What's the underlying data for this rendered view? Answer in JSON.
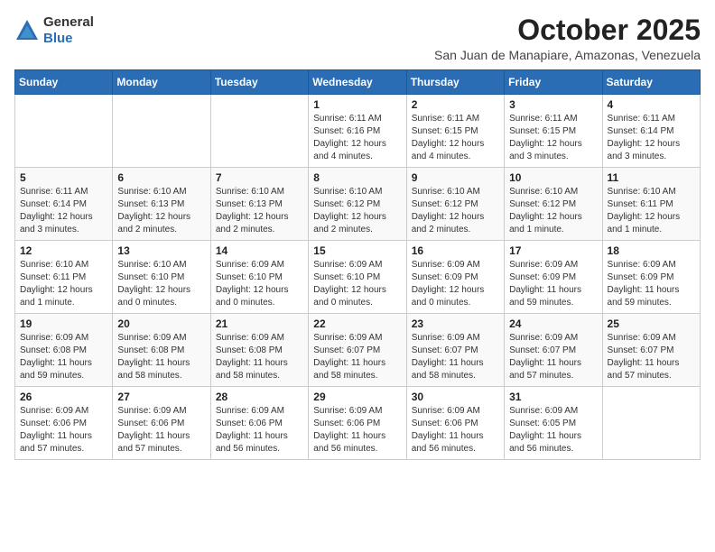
{
  "logo": {
    "general": "General",
    "blue": "Blue"
  },
  "header": {
    "title": "October 2025",
    "subtitle": "San Juan de Manapiare, Amazonas, Venezuela"
  },
  "weekdays": [
    "Sunday",
    "Monday",
    "Tuesday",
    "Wednesday",
    "Thursday",
    "Friday",
    "Saturday"
  ],
  "weeks": [
    [
      {
        "day": "",
        "info": ""
      },
      {
        "day": "",
        "info": ""
      },
      {
        "day": "",
        "info": ""
      },
      {
        "day": "1",
        "info": "Sunrise: 6:11 AM\nSunset: 6:16 PM\nDaylight: 12 hours\nand 4 minutes."
      },
      {
        "day": "2",
        "info": "Sunrise: 6:11 AM\nSunset: 6:15 PM\nDaylight: 12 hours\nand 4 minutes."
      },
      {
        "day": "3",
        "info": "Sunrise: 6:11 AM\nSunset: 6:15 PM\nDaylight: 12 hours\nand 3 minutes."
      },
      {
        "day": "4",
        "info": "Sunrise: 6:11 AM\nSunset: 6:14 PM\nDaylight: 12 hours\nand 3 minutes."
      }
    ],
    [
      {
        "day": "5",
        "info": "Sunrise: 6:11 AM\nSunset: 6:14 PM\nDaylight: 12 hours\nand 3 minutes."
      },
      {
        "day": "6",
        "info": "Sunrise: 6:10 AM\nSunset: 6:13 PM\nDaylight: 12 hours\nand 2 minutes."
      },
      {
        "day": "7",
        "info": "Sunrise: 6:10 AM\nSunset: 6:13 PM\nDaylight: 12 hours\nand 2 minutes."
      },
      {
        "day": "8",
        "info": "Sunrise: 6:10 AM\nSunset: 6:12 PM\nDaylight: 12 hours\nand 2 minutes."
      },
      {
        "day": "9",
        "info": "Sunrise: 6:10 AM\nSunset: 6:12 PM\nDaylight: 12 hours\nand 2 minutes."
      },
      {
        "day": "10",
        "info": "Sunrise: 6:10 AM\nSunset: 6:12 PM\nDaylight: 12 hours\nand 1 minute."
      },
      {
        "day": "11",
        "info": "Sunrise: 6:10 AM\nSunset: 6:11 PM\nDaylight: 12 hours\nand 1 minute."
      }
    ],
    [
      {
        "day": "12",
        "info": "Sunrise: 6:10 AM\nSunset: 6:11 PM\nDaylight: 12 hours\nand 1 minute."
      },
      {
        "day": "13",
        "info": "Sunrise: 6:10 AM\nSunset: 6:10 PM\nDaylight: 12 hours\nand 0 minutes."
      },
      {
        "day": "14",
        "info": "Sunrise: 6:09 AM\nSunset: 6:10 PM\nDaylight: 12 hours\nand 0 minutes."
      },
      {
        "day": "15",
        "info": "Sunrise: 6:09 AM\nSunset: 6:10 PM\nDaylight: 12 hours\nand 0 minutes."
      },
      {
        "day": "16",
        "info": "Sunrise: 6:09 AM\nSunset: 6:09 PM\nDaylight: 12 hours\nand 0 minutes."
      },
      {
        "day": "17",
        "info": "Sunrise: 6:09 AM\nSunset: 6:09 PM\nDaylight: 11 hours\nand 59 minutes."
      },
      {
        "day": "18",
        "info": "Sunrise: 6:09 AM\nSunset: 6:09 PM\nDaylight: 11 hours\nand 59 minutes."
      }
    ],
    [
      {
        "day": "19",
        "info": "Sunrise: 6:09 AM\nSunset: 6:08 PM\nDaylight: 11 hours\nand 59 minutes."
      },
      {
        "day": "20",
        "info": "Sunrise: 6:09 AM\nSunset: 6:08 PM\nDaylight: 11 hours\nand 58 minutes."
      },
      {
        "day": "21",
        "info": "Sunrise: 6:09 AM\nSunset: 6:08 PM\nDaylight: 11 hours\nand 58 minutes."
      },
      {
        "day": "22",
        "info": "Sunrise: 6:09 AM\nSunset: 6:07 PM\nDaylight: 11 hours\nand 58 minutes."
      },
      {
        "day": "23",
        "info": "Sunrise: 6:09 AM\nSunset: 6:07 PM\nDaylight: 11 hours\nand 58 minutes."
      },
      {
        "day": "24",
        "info": "Sunrise: 6:09 AM\nSunset: 6:07 PM\nDaylight: 11 hours\nand 57 minutes."
      },
      {
        "day": "25",
        "info": "Sunrise: 6:09 AM\nSunset: 6:07 PM\nDaylight: 11 hours\nand 57 minutes."
      }
    ],
    [
      {
        "day": "26",
        "info": "Sunrise: 6:09 AM\nSunset: 6:06 PM\nDaylight: 11 hours\nand 57 minutes."
      },
      {
        "day": "27",
        "info": "Sunrise: 6:09 AM\nSunset: 6:06 PM\nDaylight: 11 hours\nand 57 minutes."
      },
      {
        "day": "28",
        "info": "Sunrise: 6:09 AM\nSunset: 6:06 PM\nDaylight: 11 hours\nand 56 minutes."
      },
      {
        "day": "29",
        "info": "Sunrise: 6:09 AM\nSunset: 6:06 PM\nDaylight: 11 hours\nand 56 minutes."
      },
      {
        "day": "30",
        "info": "Sunrise: 6:09 AM\nSunset: 6:06 PM\nDaylight: 11 hours\nand 56 minutes."
      },
      {
        "day": "31",
        "info": "Sunrise: 6:09 AM\nSunset: 6:05 PM\nDaylight: 11 hours\nand 56 minutes."
      },
      {
        "day": "",
        "info": ""
      }
    ]
  ]
}
